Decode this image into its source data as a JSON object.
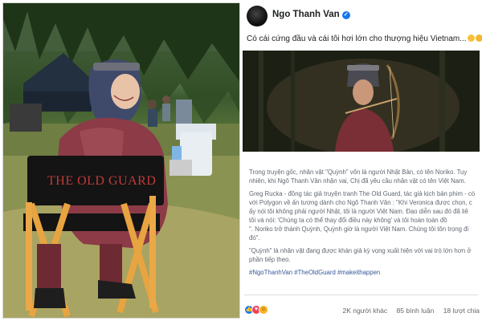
{
  "left_photo": {
    "description_icon": "photo-icon",
    "chair_text": "THE OLD GUARD"
  },
  "post": {
    "author_name": "Ngo Thanh Van",
    "verified_icon": "check-icon",
    "caption": "Có cái cứng đầu và cái tôi hơi lớn cho thượng hiệu Vietnam...",
    "caption_emojis": [
      "smile-emoji",
      "grin-emoji",
      "heart-emoji"
    ],
    "heart_glyph": "❤",
    "article_paragraphs": [
      "Trong truyện gốc, nhân vật \"Quỳnh\" vốn là người Nhật Bản, có tên Noriko. Tuy",
      "nhiên, khi Ngô Thanh Vân nhận vai, Chị đã yêu cầu nhân vật có tên Việt Nam.",
      "Greg Rucka - đồng tác giả truyện tranh The Old Guard, tác giả kịch bản phim - có",
      "với Polygon về ấn tượng dành cho Ngô Thanh Vân : \"Khi Veronica được chọn, c",
      "ấy nói tôi không phải người Nhật, tôi là người Việt Nam. Đạo diễn sau đó đã liê",
      "tôi và nói: 'Chúng ta có thể thay đổi điều này không' và tôi hoàn toàn đồ",
      "\". Noriko trở thành Quỳnh, Quỳnh giờ là người Việt Nam. Chúng tôi tôn trọng đi",
      "đó\".",
      "\"Quỳnh\" là nhân vật đang được khán giả kỳ vọng xuất hiện với vai trò lớn hơn ở",
      "phần tiếp theo."
    ],
    "hashtags": "#NgoThanhVan #TheOldGuard #makeithappen",
    "reactions": {
      "icons": [
        "like-icon",
        "love-icon",
        "haha-icon"
      ],
      "like_glyph": "👍",
      "love_glyph": "♥",
      "haha_glyph": "☺",
      "count": "2K người khác",
      "comments": "85 bình luận",
      "shares": "18 lượt chia"
    }
  }
}
